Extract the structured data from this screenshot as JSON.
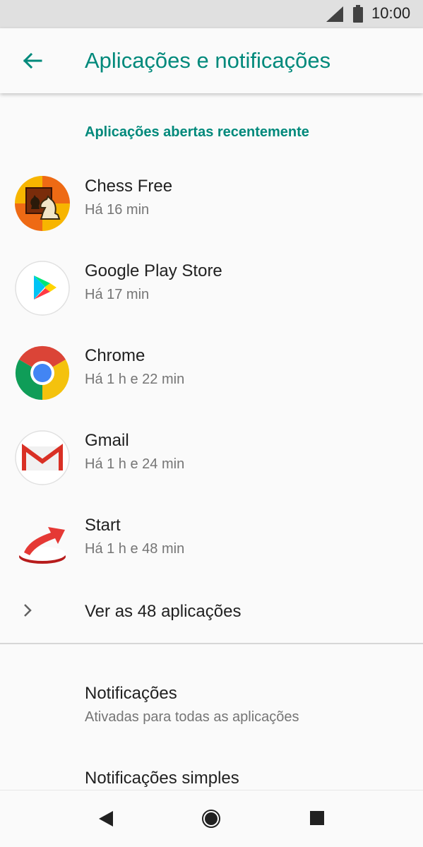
{
  "status_bar": {
    "time": "10:00",
    "icons": [
      "signal-icon",
      "battery-icon"
    ]
  },
  "app_bar": {
    "back_icon": "arrow-back-icon",
    "title": "Aplicações e notificações"
  },
  "recent": {
    "header": "Aplicações abertas recentemente",
    "apps": [
      {
        "name": "Chess Free",
        "time": "Há 16 min",
        "icon": "chess-free-icon"
      },
      {
        "name": "Google Play Store",
        "time": "Há 17 min",
        "icon": "google-play-store-icon"
      },
      {
        "name": "Chrome",
        "time": "Há 1 h e 22 min",
        "icon": "chrome-icon"
      },
      {
        "name": "Gmail",
        "time": "Há 1 h e 24 min",
        "icon": "gmail-icon"
      },
      {
        "name": "Start",
        "time": "Há 1 h e 48 min",
        "icon": "start-icon"
      }
    ],
    "see_all": "Ver as 48 aplicações"
  },
  "settings": [
    {
      "title": "Notificações",
      "subtitle": "Ativadas para todas as aplicações"
    },
    {
      "title": "Notificações simples",
      "subtitle": ""
    }
  ],
  "nav_bar": {
    "icons": [
      "back-nav-icon",
      "home-nav-icon",
      "recents-nav-icon"
    ]
  },
  "colors": {
    "accent": "#00897b",
    "status_bar": "#e0e0e0",
    "background": "#fafafa",
    "secondary_text": "#757575"
  }
}
